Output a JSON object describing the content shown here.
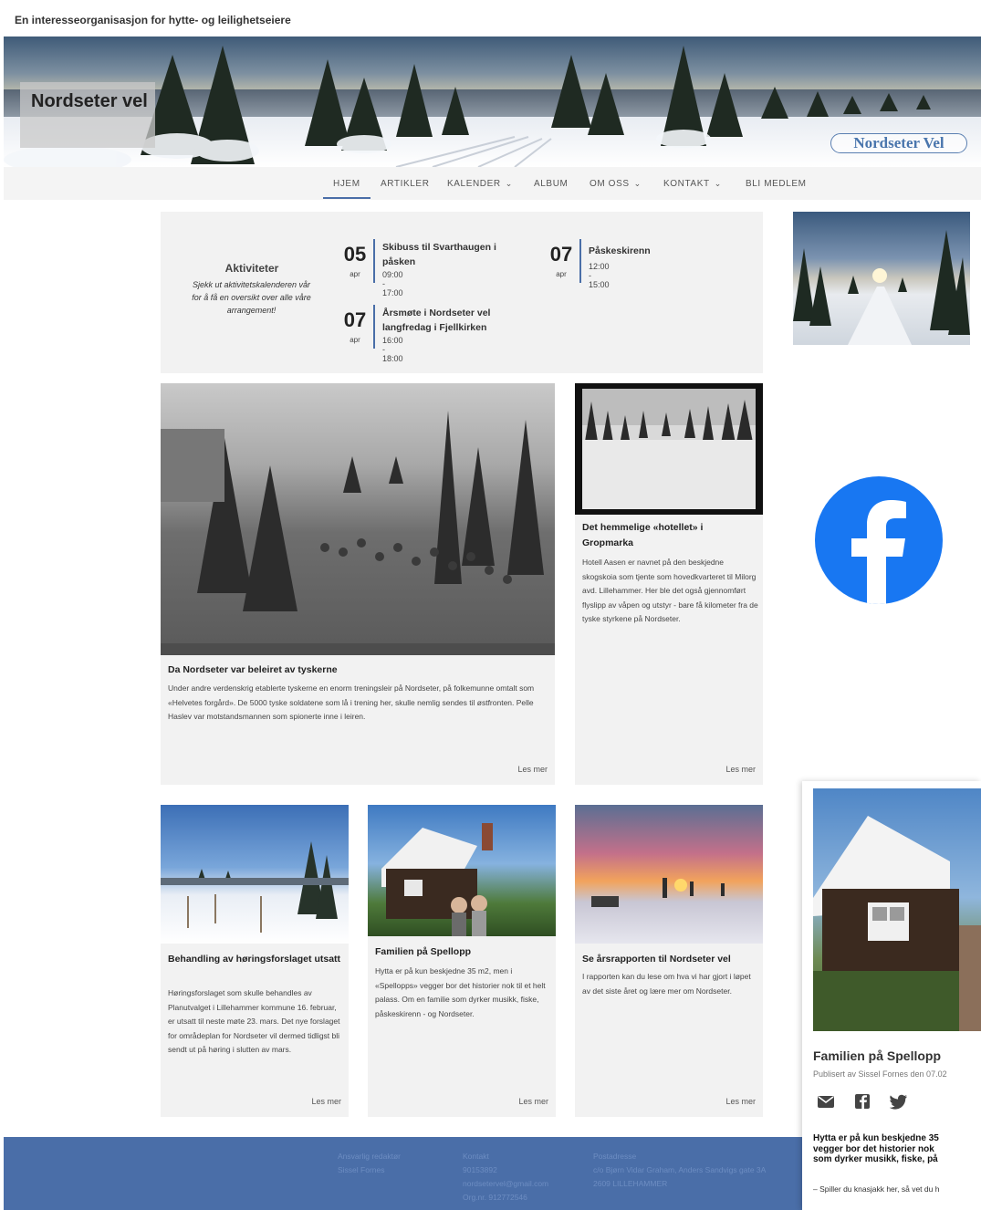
{
  "site": {
    "tagline": "En interesseorganisasjon for hytte- og leilighetseiere",
    "hero_title": "Nordseter vel",
    "hero_logo": "Nordseter Vel"
  },
  "nav": {
    "items": [
      {
        "label": "HJEM",
        "dropdown": false,
        "active": true
      },
      {
        "label": "ARTIKLER",
        "dropdown": false
      },
      {
        "label": "KALENDER",
        "dropdown": true
      },
      {
        "label": "ALBUM",
        "dropdown": false
      },
      {
        "label": "OM OSS",
        "dropdown": true
      },
      {
        "label": "KONTAKT",
        "dropdown": true
      },
      {
        "label": "BLI MEDLEM",
        "dropdown": false
      }
    ],
    "chevron_icon": "chevron-down-icon"
  },
  "activities": {
    "title": "Aktiviteter",
    "subtitle": "Sjekk ut aktivitetskalenderen vår for å få en oversikt over alle våre arrangement!",
    "events": [
      {
        "day": "05",
        "month": "apr",
        "title": "Skibuss til Svarthaugen i påsken",
        "time": "09:00 - 17:00"
      },
      {
        "day": "07",
        "month": "apr",
        "title": "Påskeskirenn",
        "time": "12:00 - 15:00"
      },
      {
        "day": "07",
        "month": "apr",
        "title": "Årsmøte i Nordseter vel langfredag i Fjellkirken",
        "time": "16:00 - 18:00"
      }
    ]
  },
  "articles": [
    {
      "title": "Da Nordseter var beleiret av tyskerne",
      "text": "Under andre verdenskrig etablerte tyskerne en enorm treningsleir på Nordseter, på folkemunne omtalt som «Helvetes forgård». De 5000 tyske soldatene som lå i trening her, skulle nemlig sendes til østfronten. Pelle Haslev var motstandsmannen som spionerte inne i leiren.",
      "more": "Les mer"
    },
    {
      "title": "Det hemmelige «hotellet» i Gropmarka",
      "text": "Hotell Aasen er navnet på den beskjedne skogskoia som tjente som hovedkvarteret til Milorg avd. Lillehammer. Her ble det også gjennomført flyslipp av våpen og utstyr - bare få kilometer fra de tyske styrkene på Nordseter.",
      "more": "Les mer"
    },
    {
      "title": "Behandling av høringsforslaget utsatt",
      "text": "Høringsforslaget som skulle behandles av Planutvalget i Lillehammer kommune 16. februar, er utsatt til neste møte 23. mars. Det nye forslaget for områdeplan for Nordseter vil dermed tidligst bli sendt ut på høring i slutten av mars.",
      "more": "Les mer"
    },
    {
      "title": "Familien på Spellopp",
      "text": "Hytta er på kun beskjedne 35 m2, men i «Spellopps» vegger bor det historier nok til et helt palass. Om en familie som dyrker musikk, fiske, påskeskirenn - og Nordseter.",
      "more": "Les mer"
    },
    {
      "title": "Se årsrapporten til Nordseter vel",
      "text": "I rapporten kan du lese om hva vi har gjort i løpet av det siste året og lære mer om Nordseter.",
      "more": "Les mer"
    }
  ],
  "footer": {
    "columns": [
      {
        "heading": "Ansvarlig redaktør",
        "lines": [
          "Sissel Fornes"
        ]
      },
      {
        "heading": "Kontakt",
        "lines": [
          "90153892",
          "nordsetervel@gmail.com",
          "Org.nr. 912772546"
        ]
      },
      {
        "heading": "Postadresse",
        "lines": [
          "c/o Bjørn Vidar Graham, Anders Sandvigs gate 3A",
          "2609 LILLEHAMMER"
        ]
      }
    ]
  },
  "share_popup": {
    "title": "Familien på Spellopp",
    "byline": "Publisert av Sissel Fornes den 07.02",
    "icons": [
      "mail-icon",
      "facebook-icon",
      "twitter-icon"
    ],
    "lead_lines": [
      "Hytta er på kun beskjedne 35",
      "vegger bor det historier nok",
      "som dyrker musikk, fiske, på"
    ],
    "body": "– Spiller du knasjakk her, så vet du h"
  },
  "colors": {
    "accent": "#4a6ea8",
    "facebook": "#1877f2",
    "card_bg": "#f2f2f2"
  }
}
